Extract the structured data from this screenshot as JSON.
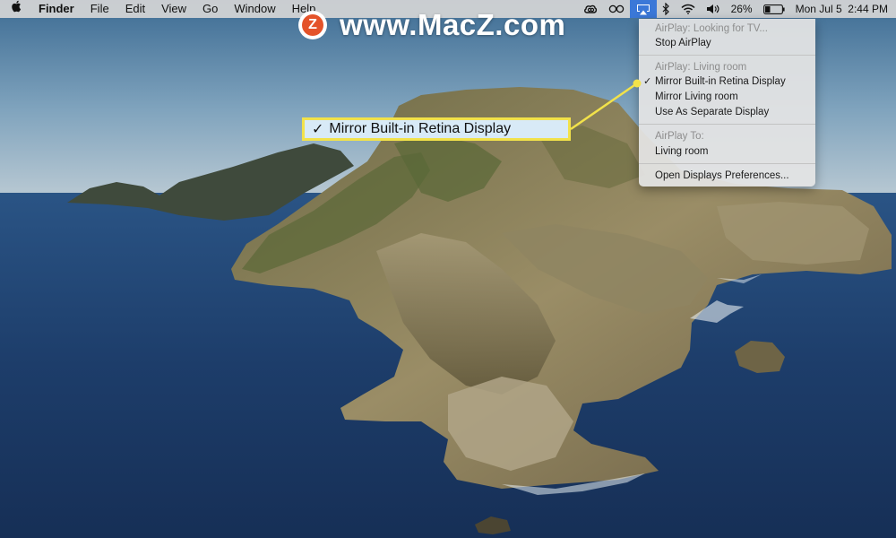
{
  "menubar": {
    "apple_icon": "apple-logo-icon",
    "items": [
      {
        "label": "Finder",
        "bold": true
      },
      {
        "label": "File"
      },
      {
        "label": "Edit"
      },
      {
        "label": "View"
      },
      {
        "label": "Go"
      },
      {
        "label": "Window"
      },
      {
        "label": "Help"
      }
    ],
    "status_icons": [
      "creative-cloud-icon",
      "glasses-icon",
      "airplay-icon",
      "bluetooth-icon",
      "wifi-icon",
      "volume-icon"
    ],
    "battery_percent": "26%",
    "clock": "Mon Jul 5  2:44 PM",
    "accent_color": "#3b78d8"
  },
  "watermark": {
    "text": "www.MacZ.com",
    "logo_letter": "Z",
    "logo_color": "#e4532a"
  },
  "airplay_menu": {
    "items": [
      {
        "label": "AirPlay: Looking for TV...",
        "disabled": true
      },
      {
        "label": "Stop AirPlay"
      },
      {
        "label": "AirPlay: Living room",
        "disabled": true
      },
      {
        "label": "Mirror Built-in Retina Display",
        "checked": true
      },
      {
        "label": "Mirror Living room"
      },
      {
        "label": "Use As Separate Display"
      },
      {
        "label": "AirPlay To:",
        "disabled": true
      },
      {
        "label": "Living room"
      },
      {
        "label": "Open Displays Preferences..."
      }
    ]
  },
  "callout": {
    "check": "✓",
    "label": "Mirror Built-in Retina Display",
    "border_color": "#f2e24a",
    "fill_color": "#d8eaf7"
  }
}
